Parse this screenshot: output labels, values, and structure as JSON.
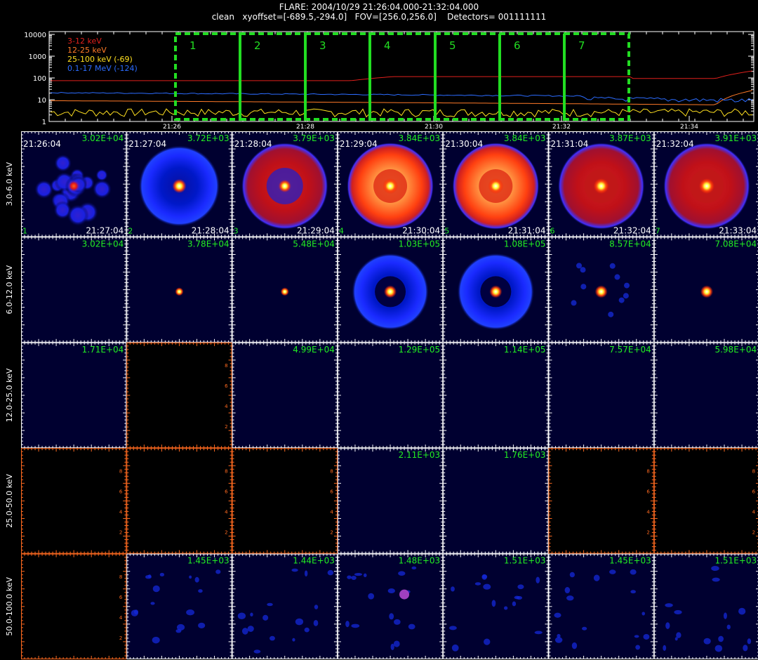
{
  "header": {
    "title": "FLARE: 2004/10/29 21:26:04.000-21:32:04.000",
    "subtitle": "clean   xyoffset=[-689.5,-294.0]   FOV=[256.0,256.0]    Detectors= 001111111"
  },
  "lightcurve": {
    "y_ticks": [
      "10000",
      "1000",
      "100",
      "10",
      "1"
    ],
    "x_ticks": [
      "21:26",
      "21:28",
      "21:30",
      "21:32",
      "21:34"
    ],
    "legend": [
      {
        "label": "3-12 keV",
        "color": "#e0201c"
      },
      {
        "label": "12-25 keV",
        "color": "#ff7a28"
      },
      {
        "label": "25-100 keV (-69)",
        "color": "#ffe020"
      },
      {
        "label": "0.1-17 MeV (-124)",
        "color": "#2c6cff"
      }
    ],
    "intervals": [
      "1",
      "2",
      "3",
      "4",
      "5",
      "6",
      "7"
    ],
    "interval_color": "#22dd22"
  },
  "columns": {
    "start_times": [
      "21:26:04",
      "21:27:04",
      "21:28:04",
      "21:29:04",
      "21:30:04",
      "21:31:04",
      "21:32:04"
    ],
    "end_times": [
      "21:27:04",
      "21:28:04",
      "21:29:04",
      "21:30:04",
      "21:31:04",
      "21:32:04",
      "21:33:04"
    ],
    "numbers": [
      "1",
      "2",
      "3",
      "4",
      "5",
      "6",
      "7"
    ]
  },
  "rows": [
    {
      "label": "3.0-6.0 keV",
      "maxima": [
        "3.02E+04",
        "3.72E+03",
        "3.79E+03",
        "3.84E+03",
        "3.84E+03",
        "3.87E+03",
        "3.91E+03"
      ],
      "empty": [
        false,
        false,
        false,
        false,
        false,
        false,
        false
      ]
    },
    {
      "label": "6.0-12.0 keV",
      "maxima": [
        "3.02E+04",
        "3.78E+04",
        "5.48E+04",
        "1.03E+05",
        "1.08E+05",
        "8.57E+04",
        "7.08E+04"
      ],
      "empty": [
        false,
        false,
        false,
        false,
        false,
        false,
        false
      ]
    },
    {
      "label": "12.0-25.0 keV",
      "maxima": [
        "1.71E+04",
        "",
        "4.99E+04",
        "1.29E+05",
        "1.14E+05",
        "7.57E+04",
        "5.98E+04"
      ],
      "empty": [
        false,
        true,
        false,
        false,
        false,
        false,
        false
      ]
    },
    {
      "label": "25.0-50.0 keV",
      "maxima": [
        "",
        "",
        "",
        "2.11E+03",
        "1.76E+03",
        "",
        ""
      ],
      "empty": [
        true,
        true,
        true,
        false,
        false,
        true,
        true
      ]
    },
    {
      "label": "50.0-100.0 keV",
      "maxima": [
        "",
        "1.45E+03",
        "1.44E+03",
        "1.48E+03",
        "1.51E+03",
        "1.45E+03",
        "1.51E+03"
      ],
      "empty": [
        true,
        false,
        false,
        false,
        false,
        false,
        false
      ]
    }
  ],
  "empty_axis_ticks": [
    "2",
    "4",
    "6",
    "8"
  ],
  "colors": {
    "background": "#000000",
    "image_background": "#000030",
    "max_label": "#22ee22",
    "empty_axis": "#ff6a20"
  }
}
